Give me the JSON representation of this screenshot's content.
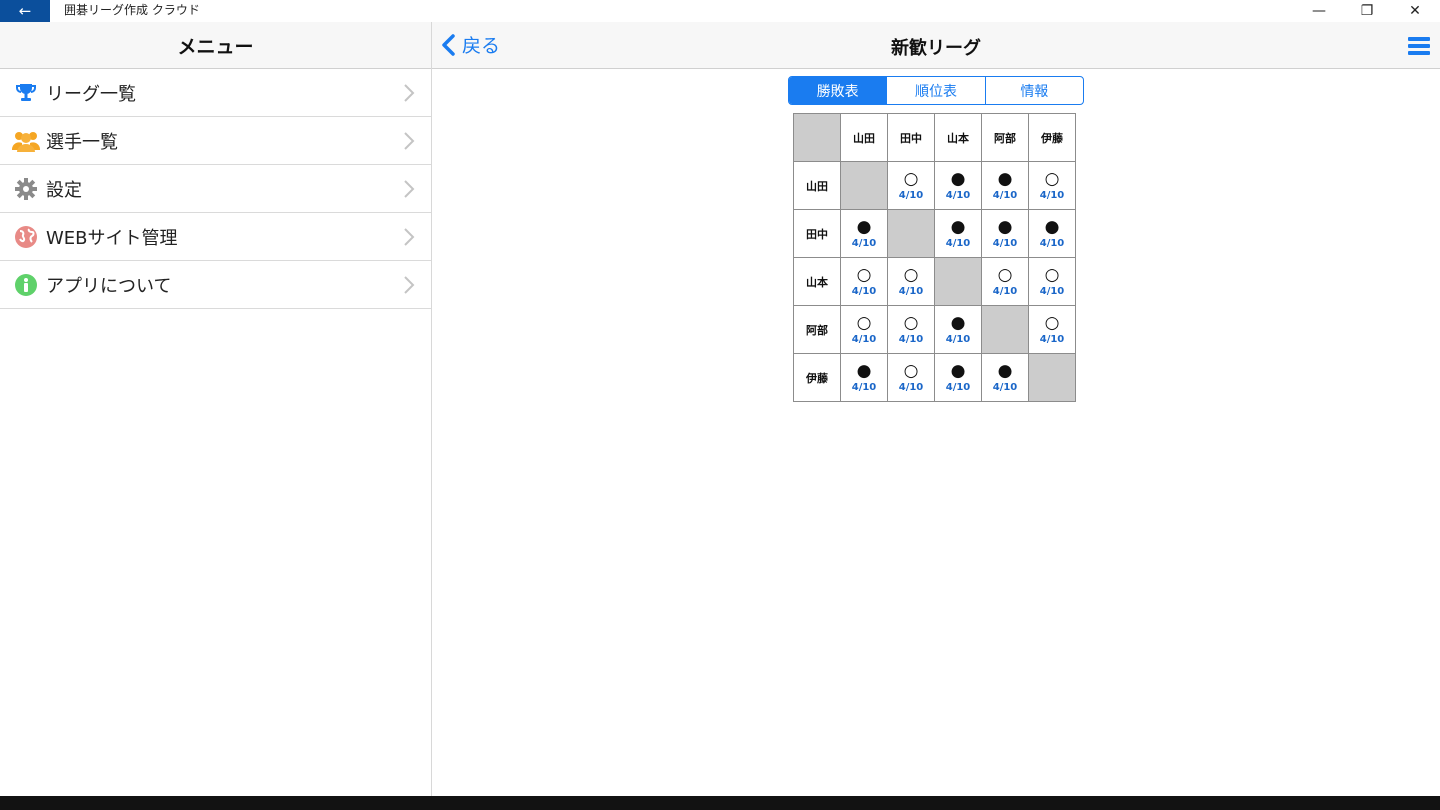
{
  "window": {
    "title": "囲碁リーグ作成 クラウド",
    "back_glyph": "←",
    "min_glyph": "—",
    "restore_glyph": "❐",
    "close_glyph": "✕"
  },
  "sidebar": {
    "title": "メニュー",
    "items": [
      {
        "label": "リーグ一覧",
        "icon": "trophy-icon"
      },
      {
        "label": "選手一覧",
        "icon": "users-icon"
      },
      {
        "label": "設定",
        "icon": "gear-icon"
      },
      {
        "label": "WEBサイト管理",
        "icon": "globe-icon"
      },
      {
        "label": "アプリについて",
        "icon": "info-icon"
      }
    ]
  },
  "nav": {
    "back_label": "戻る",
    "title": "新歓リーグ"
  },
  "tabs": [
    {
      "label": "勝敗表",
      "active": true
    },
    {
      "label": "順位表",
      "active": false
    },
    {
      "label": "情報",
      "active": false
    }
  ],
  "table": {
    "players": [
      "山田",
      "田中",
      "山本",
      "阿部",
      "伊藤"
    ],
    "rows": [
      [
        null,
        {
          "r": "○",
          "d": "4/10"
        },
        {
          "r": "●",
          "d": "4/10"
        },
        {
          "r": "●",
          "d": "4/10"
        },
        {
          "r": "○",
          "d": "4/10"
        }
      ],
      [
        {
          "r": "●",
          "d": "4/10"
        },
        null,
        {
          "r": "●",
          "d": "4/10"
        },
        {
          "r": "●",
          "d": "4/10"
        },
        {
          "r": "●",
          "d": "4/10"
        }
      ],
      [
        {
          "r": "○",
          "d": "4/10"
        },
        {
          "r": "○",
          "d": "4/10"
        },
        null,
        {
          "r": "○",
          "d": "4/10"
        },
        {
          "r": "○",
          "d": "4/10"
        }
      ],
      [
        {
          "r": "○",
          "d": "4/10"
        },
        {
          "r": "○",
          "d": "4/10"
        },
        {
          "r": "●",
          "d": "4/10"
        },
        null,
        {
          "r": "○",
          "d": "4/10"
        }
      ],
      [
        {
          "r": "●",
          "d": "4/10"
        },
        {
          "r": "○",
          "d": "4/10"
        },
        {
          "r": "●",
          "d": "4/10"
        },
        {
          "r": "●",
          "d": "4/10"
        },
        null
      ]
    ]
  },
  "colors": {
    "accent": "#1a7cf0",
    "titlebar_back": "#0b4f9c",
    "cell_gray": "#cccccc"
  }
}
